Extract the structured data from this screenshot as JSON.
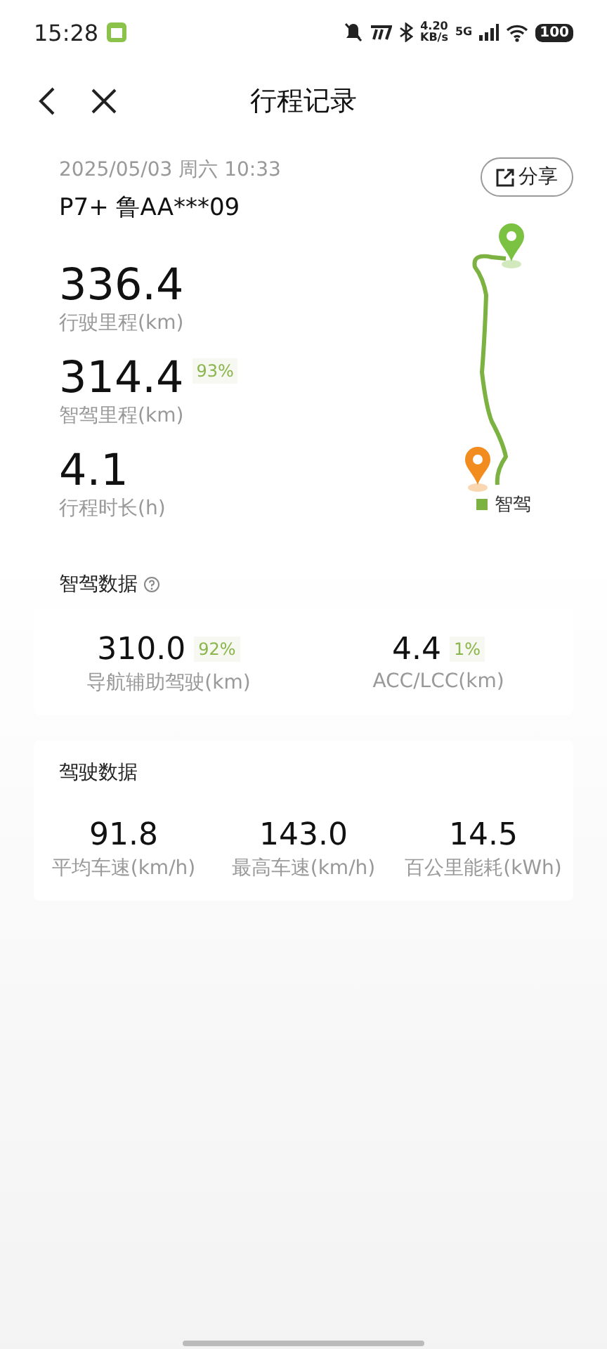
{
  "status_bar": {
    "time": "15:28",
    "speed": "4.20",
    "speed_unit": "KB/s",
    "network": "5G",
    "battery": "100"
  },
  "header": {
    "title": "行程记录"
  },
  "trip": {
    "datetime": "2025/05/03 周六 10:33",
    "vehicle": "P7+ 鲁AA***09",
    "share": "分享",
    "metrics": [
      {
        "value": "336.4",
        "label": "行驶里程(km)"
      },
      {
        "value": "314.4",
        "badge": "93%",
        "label": "智驾里程(km)"
      },
      {
        "value": "4.1",
        "label": "行程时长(h)"
      }
    ],
    "legend": "智驾"
  },
  "smart_driving": {
    "title": "智驾数据",
    "items": [
      {
        "value": "310.0",
        "badge": "92%",
        "label": "导航辅助驾驶(km)"
      },
      {
        "value": "4.4",
        "badge": "1%",
        "label": "ACC/LCC(km)"
      }
    ]
  },
  "driving": {
    "title": "驾驶数据",
    "items": [
      {
        "value": "91.8",
        "label": "平均车速(km/h)"
      },
      {
        "value": "143.0",
        "label": "最高车速(km/h)"
      },
      {
        "value": "14.5",
        "label": "百公里能耗(kWh)"
      }
    ]
  }
}
